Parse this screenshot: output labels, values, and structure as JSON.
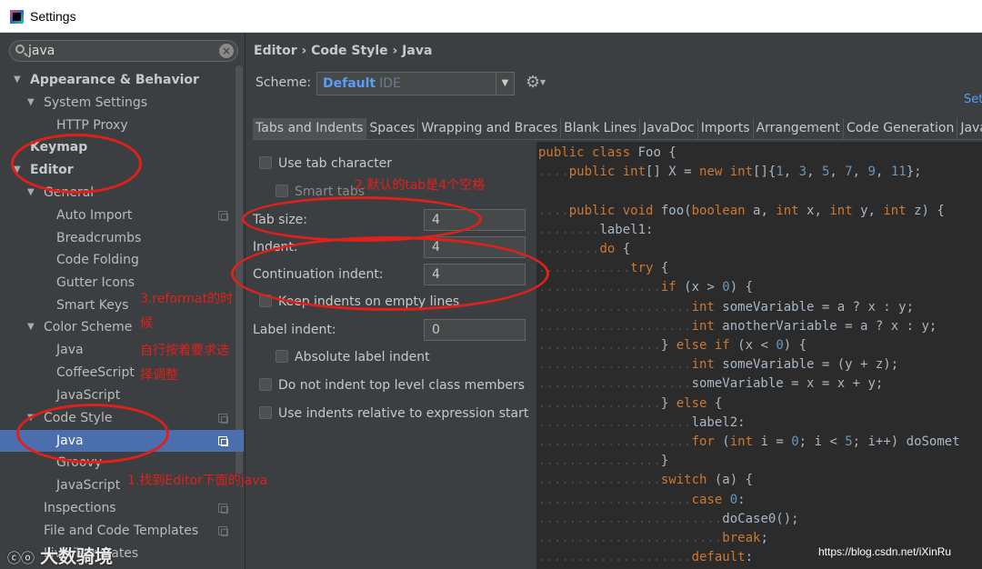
{
  "window": {
    "title": "Settings"
  },
  "search": {
    "value": "java"
  },
  "tree": {
    "appearance": "Appearance & Behavior",
    "system_settings": "System Settings",
    "http_proxy": "HTTP Proxy",
    "keymap": "Keymap",
    "editor": "Editor",
    "general": "General",
    "auto_import": "Auto Import",
    "breadcrumbs": "Breadcrumbs",
    "code_folding": "Code Folding",
    "gutter_icons": "Gutter Icons",
    "smart_keys": "Smart Keys",
    "color_scheme": "Color Scheme",
    "cs_java": "Java",
    "coffeescript": "CoffeeScript",
    "cs_javascript": "JavaScript",
    "code_style": "Code Style",
    "code_style_java": "Java",
    "groovy": "Groovy",
    "code_style_javascript": "JavaScript",
    "inspections": "Inspections",
    "file_templates": "File and Code Templates",
    "last": "Live Templates"
  },
  "breadcrumb": {
    "a": "Editor",
    "sep": "›",
    "b": "Code Style",
    "c": "Java"
  },
  "scheme": {
    "label": "Scheme:",
    "value": "Default",
    "suffix": "IDE"
  },
  "set_link": "Set",
  "tabs": [
    "Tabs and Indents",
    "Spaces",
    "Wrapping and Braces",
    "Blank Lines",
    "JavaDoc",
    "Imports",
    "Arrangement",
    "Code Generation",
    "Java EE Nar"
  ],
  "options": {
    "use_tab": "Use tab character",
    "smart_tabs": "Smart tabs",
    "tab_size_label": "Tab size:",
    "tab_size": "4",
    "indent_label": "Indent:",
    "indent": "4",
    "cont_label": "Continuation indent:",
    "cont": "4",
    "keep_indents": "Keep indents on empty lines",
    "label_indent_label": "Label indent:",
    "label_indent": "0",
    "absolute_label": "Absolute label indent",
    "no_indent_top": "Do not indent top level class members",
    "relative_indent": "Use indents relative to expression start"
  },
  "annotations": {
    "a1": "1.找到Editor下面的java",
    "a2": "2.默认的tab是4个空格",
    "a3_1": "3.reformat的时",
    "a3_2": "候",
    "a3_3": "自行按着要求选",
    "a3_4": "择调整",
    "color": "#e0201a"
  },
  "watermark": {
    "logo": "ⓒⓞ",
    "left": "大数骑境",
    "right": "https://blog.csdn.net/iXinRu"
  },
  "colors": {
    "selection": "#4b6eaf",
    "keyword": "#cc7832",
    "number": "#6897bb",
    "link": "#589df6"
  }
}
